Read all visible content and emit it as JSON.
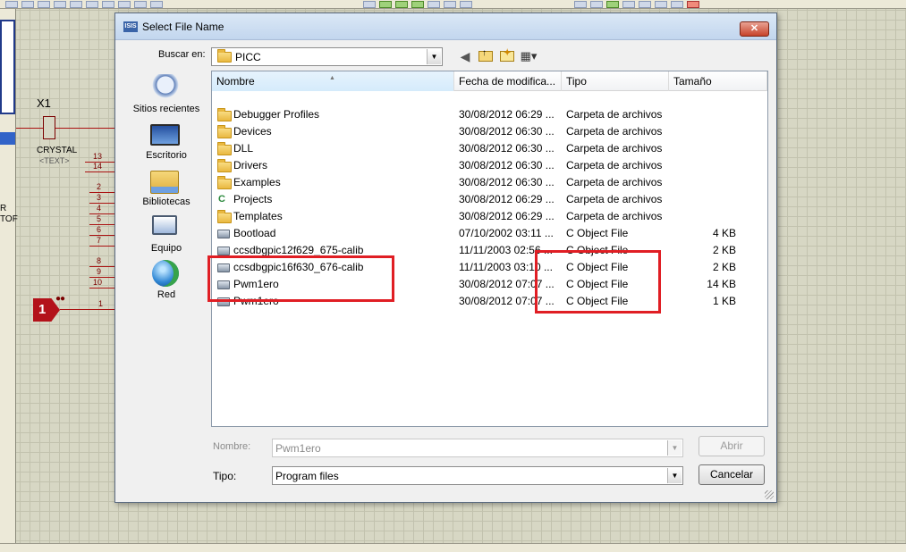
{
  "background_app": {
    "component_ref": "X1",
    "component_name": "CRYSTAL",
    "component_text": "<TEXT>",
    "pin_numbers": [
      "13",
      "14",
      "2",
      "3",
      "4",
      "5",
      "6",
      "7",
      "8",
      "9",
      "10",
      "1"
    ],
    "terminal_label": "1",
    "left_panel_fragments": [
      "R",
      "TOF"
    ]
  },
  "dialog": {
    "title": "Select File Name",
    "title_icon": "ISIS",
    "close_label": "✕",
    "look_in_label": "Buscar en:",
    "look_in_value": "PICC",
    "places": [
      {
        "label": "Sitios recientes",
        "icon": "recent-places-icon"
      },
      {
        "label": "Escritorio",
        "icon": "desktop-icon"
      },
      {
        "label": "Bibliotecas",
        "icon": "libraries-icon"
      },
      {
        "label": "Equipo",
        "icon": "computer-icon"
      },
      {
        "label": "Red",
        "icon": "network-icon"
      }
    ],
    "columns": {
      "name": "Nombre",
      "date": "Fecha de modifica...",
      "type": "Tipo",
      "size": "Tamaño"
    },
    "files": [
      {
        "name": "Debugger Profiles",
        "date": "30/08/2012 06:29 ...",
        "type": "Carpeta de archivos",
        "size": "",
        "icon": "folder-icon"
      },
      {
        "name": "Devices",
        "date": "30/08/2012 06:30 ...",
        "type": "Carpeta de archivos",
        "size": "",
        "icon": "folder-icon"
      },
      {
        "name": "DLL",
        "date": "30/08/2012 06:30 ...",
        "type": "Carpeta de archivos",
        "size": "",
        "icon": "folder-icon"
      },
      {
        "name": "Drivers",
        "date": "30/08/2012 06:30 ...",
        "type": "Carpeta de archivos",
        "size": "",
        "icon": "folder-icon"
      },
      {
        "name": "Examples",
        "date": "30/08/2012 06:30 ...",
        "type": "Carpeta de archivos",
        "size": "",
        "icon": "folder-icon"
      },
      {
        "name": "Projects",
        "date": "30/08/2012 06:29 ...",
        "type": "Carpeta de archivos",
        "size": "",
        "icon": "project-folder-icon"
      },
      {
        "name": "Templates",
        "date": "30/08/2012 06:29 ...",
        "type": "Carpeta de archivos",
        "size": "",
        "icon": "folder-icon"
      },
      {
        "name": "Bootload",
        "date": "07/10/2002 03:11 ...",
        "type": "C Object File",
        "size": "4 KB",
        "icon": "object-file-icon"
      },
      {
        "name": "ccsdbgpic12f629_675-calib",
        "date": "11/11/2003 02:56 ...",
        "type": "C Object File",
        "size": "2 KB",
        "icon": "object-file-icon"
      },
      {
        "name": "ccsdbgpic16f630_676-calib",
        "date": "11/11/2003 03:10 ...",
        "type": "C Object File",
        "size": "2 KB",
        "icon": "object-file-icon"
      },
      {
        "name": "Pwm1ero",
        "date": "30/08/2012 07:07 ...",
        "type": "C Object File",
        "size": "14 KB",
        "icon": "object-file-icon"
      },
      {
        "name": "Pwm1ero",
        "date": "30/08/2012 07:07 ...",
        "type": "C Object File",
        "size": "1 KB",
        "icon": "object-file-icon"
      }
    ],
    "filename_label": "Nombre:",
    "filename_value": "Pwm1ero",
    "filetype_label": "Tipo:",
    "filetype_value": "Program files",
    "open_button": "Abrir",
    "cancel_button": "Cancelar"
  },
  "colors": {
    "highlight": "#e01e24",
    "terminal": "#b3121a",
    "close_button": "#c7432a"
  }
}
